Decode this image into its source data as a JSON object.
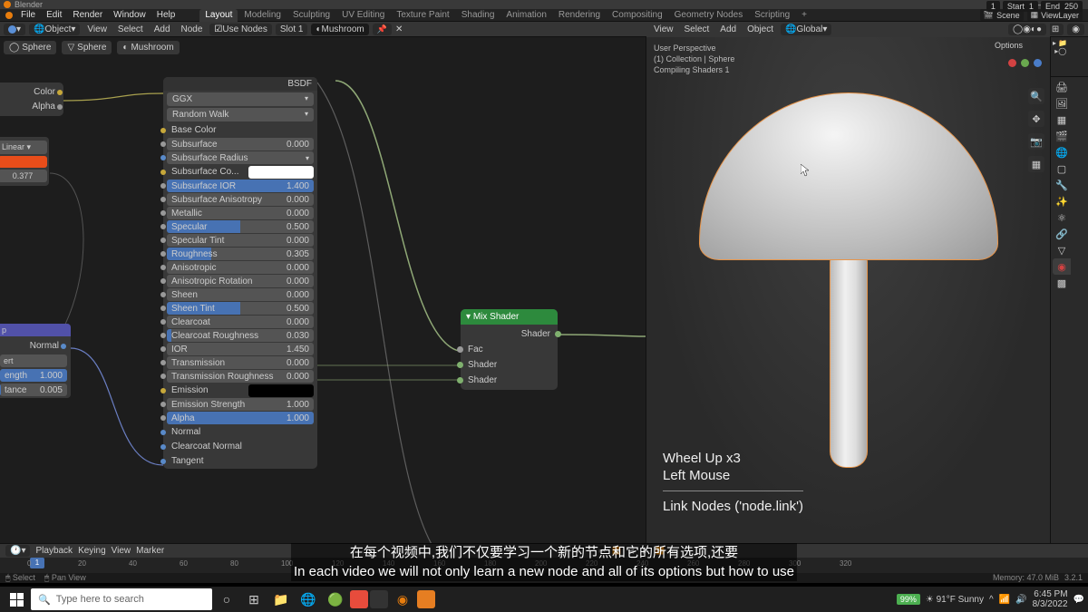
{
  "title_bar": {
    "app": "Blender"
  },
  "window_controls": {
    "min": "—",
    "max": "☐",
    "close": "✕"
  },
  "menu": [
    "File",
    "Edit",
    "Render",
    "Window",
    "Help"
  ],
  "workspaces": [
    "Layout",
    "Modeling",
    "Sculpting",
    "UV Editing",
    "Texture Paint",
    "Shading",
    "Animation",
    "Rendering",
    "Compositing",
    "Geometry Nodes",
    "Scripting",
    "+"
  ],
  "scene": {
    "label": "Scene",
    "viewlayer": "ViewLayer"
  },
  "node_header": {
    "object_mode": "Object",
    "view": "View",
    "select": "Select",
    "add": "Add",
    "node": "Node",
    "use_nodes": "Use Nodes",
    "slot": "Slot 1",
    "material": "Mushroom"
  },
  "viewport_header": {
    "view": "View",
    "select": "Select",
    "add": "Add",
    "object": "Object",
    "orientation": "Global"
  },
  "breadcrumb": [
    {
      "icon": "◯",
      "label": "Sphere"
    },
    {
      "icon": "▽",
      "label": "Sphere"
    },
    {
      "icon": "◐",
      "label": "Mushroom"
    }
  ],
  "left_partial": {
    "color": "Color",
    "alpha": "Alpha"
  },
  "small_node": {
    "linear": "Linear",
    "val": "0.377"
  },
  "normal_node": {
    "title": "p",
    "out": "Normal",
    "row1": "ert",
    "strength_l": "ength",
    "strength_v": "1.000",
    "dist_l": "tance",
    "dist_v": "0.005"
  },
  "bsdf": {
    "out": "BSDF",
    "distribution": "GGX",
    "subsurf_method": "Random Walk",
    "rows": [
      {
        "type": "label",
        "label": "Base Color",
        "dot": "dotc-yellow"
      },
      {
        "type": "slider",
        "label": "Subsurface",
        "val": "0.000",
        "fill": 0,
        "dot": "dotc-grey"
      },
      {
        "type": "drop",
        "label": "Subsurface Radius",
        "dot": "dotc-blue"
      },
      {
        "type": "color",
        "label": "Subsurface Co...",
        "dot": "dotc-yellow",
        "color": "white"
      },
      {
        "type": "slider",
        "label": "Subsurface IOR",
        "val": "1.400",
        "fill": 100,
        "dot": "dotc-grey"
      },
      {
        "type": "slider",
        "label": "Subsurface Anisotropy",
        "val": "0.000",
        "fill": 0,
        "dot": "dotc-grey"
      },
      {
        "type": "slider",
        "label": "Metallic",
        "val": "0.000",
        "fill": 0,
        "dot": "dotc-grey"
      },
      {
        "type": "slider",
        "label": "Specular",
        "val": "0.500",
        "fill": 50,
        "dot": "dotc-grey"
      },
      {
        "type": "slider",
        "label": "Specular Tint",
        "val": "0.000",
        "fill": 0,
        "dot": "dotc-grey"
      },
      {
        "type": "slider",
        "label": "Roughness",
        "val": "0.305",
        "fill": 30,
        "dot": "dotc-grey"
      },
      {
        "type": "slider",
        "label": "Anisotropic",
        "val": "0.000",
        "fill": 0,
        "dot": "dotc-grey"
      },
      {
        "type": "slider",
        "label": "Anisotropic Rotation",
        "val": "0.000",
        "fill": 0,
        "dot": "dotc-grey"
      },
      {
        "type": "slider",
        "label": "Sheen",
        "val": "0.000",
        "fill": 0,
        "dot": "dotc-grey"
      },
      {
        "type": "slider",
        "label": "Sheen Tint",
        "val": "0.500",
        "fill": 50,
        "dot": "dotc-grey"
      },
      {
        "type": "slider",
        "label": "Clearcoat",
        "val": "0.000",
        "fill": 0,
        "dot": "dotc-grey"
      },
      {
        "type": "slider",
        "label": "Clearcoat Roughness",
        "val": "0.030",
        "fill": 3,
        "dot": "dotc-grey"
      },
      {
        "type": "slider",
        "label": "IOR",
        "val": "1.450",
        "fill": 0,
        "dot": "dotc-grey"
      },
      {
        "type": "slider",
        "label": "Transmission",
        "val": "0.000",
        "fill": 0,
        "dot": "dotc-grey"
      },
      {
        "type": "slider",
        "label": "Transmission Roughness",
        "val": "0.000",
        "fill": 0,
        "dot": "dotc-grey"
      },
      {
        "type": "color",
        "label": "Emission",
        "dot": "dotc-yellow",
        "color": "black"
      },
      {
        "type": "slider",
        "label": "Emission Strength",
        "val": "1.000",
        "fill": 0,
        "dot": "dotc-grey"
      },
      {
        "type": "slider",
        "label": "Alpha",
        "val": "1.000",
        "fill": 100,
        "dot": "dotc-grey"
      },
      {
        "type": "label",
        "label": "Normal",
        "dot": "dotc-blue"
      },
      {
        "type": "label",
        "label": "Clearcoat Normal",
        "dot": "dotc-blue"
      },
      {
        "type": "label",
        "label": "Tangent",
        "dot": "dotc-blue"
      }
    ]
  },
  "mix": {
    "title": "Mix Shader",
    "out": "Shader",
    "fac": "Fac",
    "shader1": "Shader",
    "shader2": "Shader"
  },
  "vp_info": [
    "User Perspective",
    "(1) Collection | Sphere",
    "Compiling Shaders 1"
  ],
  "vp_overlay": {
    "l1": "Wheel Up x3",
    "l2": "Left Mouse",
    "l3": "Link Nodes ('node.link')"
  },
  "options": "Options",
  "timeline": {
    "playback": "Playback",
    "keying": "Keying",
    "view": "View",
    "marker": "Marker",
    "ticks": [
      "0",
      "20",
      "40",
      "60",
      "80",
      "100",
      "120",
      "140",
      "160",
      "180",
      "200",
      "220",
      "240",
      "260",
      "280",
      "300",
      "320"
    ],
    "frame": "1",
    "start_l": "Start",
    "start_v": "1",
    "end_l": "End",
    "end_v": "250",
    "curframe": "1"
  },
  "status": {
    "left1": "Select",
    "left2": "Pan View",
    "mem": "Memory: 47.0 MiB",
    "ver": "3.2.1"
  },
  "subtitle": {
    "cn": "在每个视频中,我们不仅要学习一个新的节点和它的所有选项,还要",
    "en": "In each video  we will not only learn a new node and all of its options  but how to use"
  },
  "taskbar": {
    "search": "Type here to search",
    "weather": "91°F Sunny",
    "battery": "99%",
    "time": "6:45 PM",
    "date": "8/3/2022"
  }
}
